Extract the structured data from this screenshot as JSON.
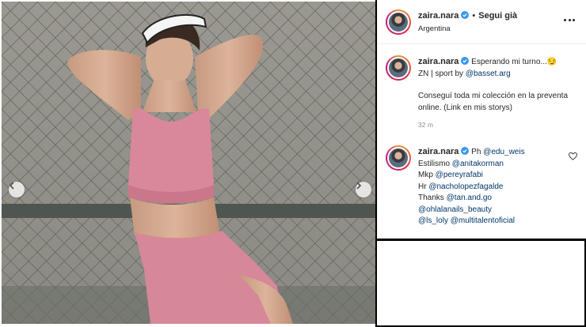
{
  "post": {
    "author": "zaira.nara",
    "follow_label": "Segui già",
    "separator": "•",
    "location": "Argentina"
  },
  "caption": {
    "author": "zaira.nara",
    "line1": "Esperando mi turno...",
    "emoji": "😏",
    "line2_prefix": "ZN | sport by ",
    "line2_mention": "@basset.arg",
    "line3": "Conseguí toda mi colección en la preventa online. (Link en mis storys)",
    "time": "32 m"
  },
  "comment": {
    "author": "zaira.nara",
    "ph_prefix": "Ph ",
    "ph_mention": "@edu_weis",
    "estilismo_prefix": "Estilismo ",
    "estilismo_mention": "@anitakorman",
    "mkp_prefix": "Mkp ",
    "mkp_mention": "@pereyrafabi",
    "hr_prefix": "Hr ",
    "hr_mention": "@nacholopezfagalde",
    "thanks_prefix": "Thanks ",
    "thanks_mention": "@tan.and.go",
    "mention_ohlala": "@ohlalanails_beauty",
    "mention_lsloly": "@ls_loly",
    "mention_multitalento": "@multitalentoficial"
  },
  "icons": {
    "verified": "verified-badge-icon",
    "more": "more-options-icon",
    "heart": "heart-icon",
    "prev": "chevron-left-icon",
    "next": "chevron-right-icon"
  },
  "colors": {
    "verified": "#3897f0",
    "mention": "#00376b",
    "outfit": "#d9889a"
  }
}
